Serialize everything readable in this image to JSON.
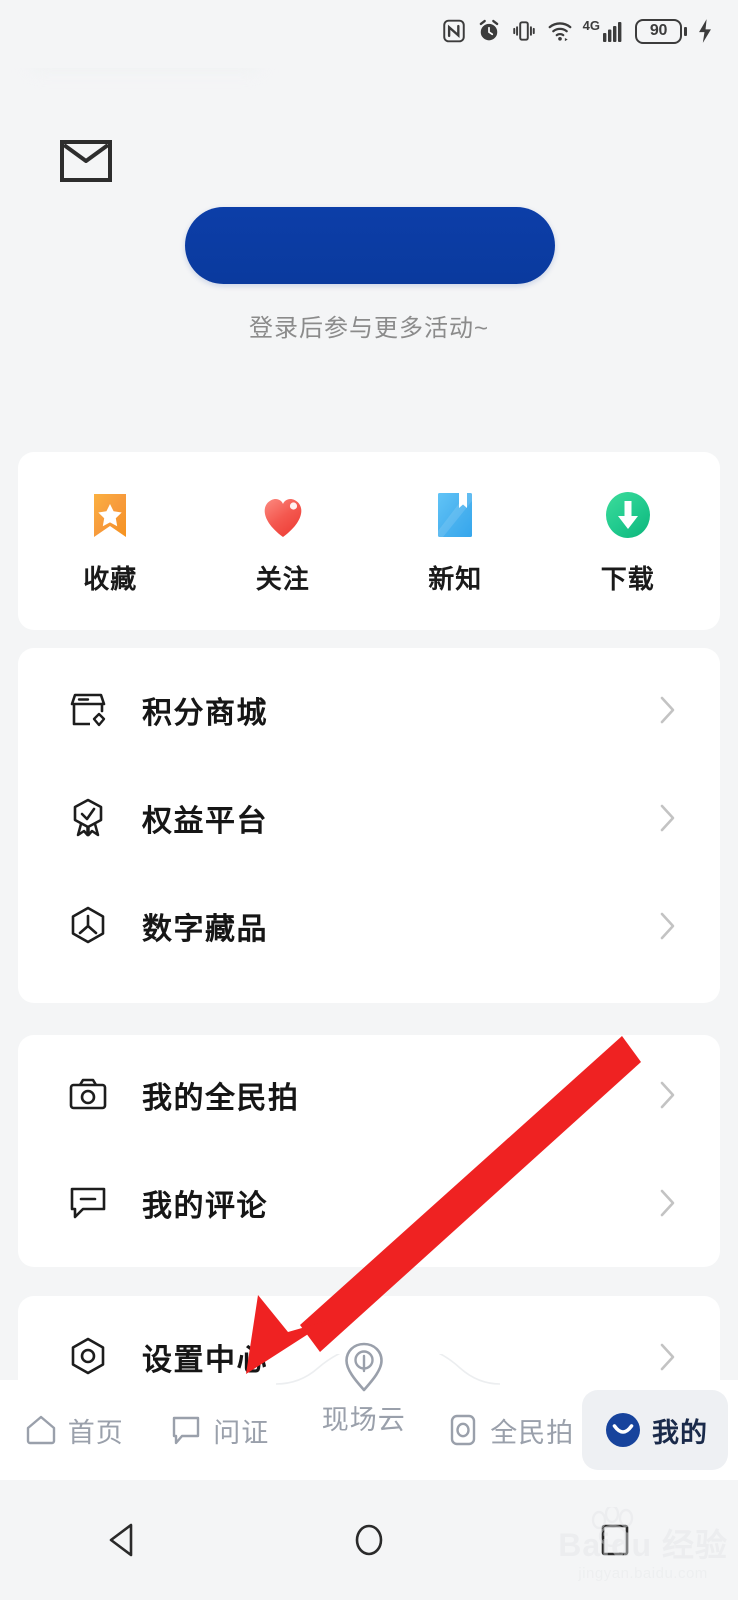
{
  "status_bar": {
    "battery_level": "90",
    "icons": [
      "nfc-icon",
      "alarm-icon",
      "vibrate-icon",
      "wifi-icon",
      "signal-4g-icon",
      "battery-icon",
      "charging-bolt-icon"
    ],
    "network": "4G"
  },
  "header": {
    "mail_icon": "envelope-icon",
    "login_button_label": "",
    "login_hint": "登录后参与更多活动~"
  },
  "quick_actions": [
    {
      "label": "收藏",
      "icon": "bookmark-star-icon",
      "color": "#f7a23b"
    },
    {
      "label": "关注",
      "icon": "heart-icon",
      "color": "#f4584f"
    },
    {
      "label": "新知",
      "icon": "book-bookmark-icon",
      "color": "#4db4f0"
    },
    {
      "label": "下载",
      "icon": "download-circle-icon",
      "color": "#1ec88a"
    }
  ],
  "service_items": [
    {
      "label": "积分商城",
      "icon": "shop-icon"
    },
    {
      "label": "权益平台",
      "icon": "medal-badge-icon"
    },
    {
      "label": "数字藏品",
      "icon": "hexagon-collection-icon"
    }
  ],
  "mine_items": [
    {
      "label": "我的全民拍",
      "icon": "camera-icon"
    },
    {
      "label": "我的评论",
      "icon": "comment-icon"
    }
  ],
  "settings_items": [
    {
      "label": "设置中心",
      "icon": "settings-hexagon-icon"
    }
  ],
  "bottom_nav": [
    {
      "label": "首页",
      "icon": "home-icon",
      "active": false
    },
    {
      "label": "问证",
      "icon": "chat-icon",
      "active": false
    },
    {
      "label": "现场云",
      "icon": "location-pin-icon",
      "active": false
    },
    {
      "label": "全民拍",
      "icon": "camera-outline-icon",
      "active": false
    },
    {
      "label": "我的",
      "icon": "profile-smile-icon",
      "active": true
    }
  ],
  "system_nav": [
    {
      "name": "back-button",
      "icon": "triangle-left-icon"
    },
    {
      "name": "home-button",
      "icon": "circle-icon"
    },
    {
      "name": "recents-button",
      "icon": "square-icon"
    }
  ],
  "annotation": {
    "type": "red-arrow",
    "points_to": "设置中心",
    "color": "#ef2222"
  },
  "watermark": {
    "brand": "Baidu 经验",
    "url": "jingyan.baidu.com"
  },
  "colors": {
    "page_background": "#f4f5f6",
    "card_background": "#ffffff",
    "primary_blue": "#0c3ea8",
    "text_primary": "#161616",
    "text_muted": "#8b8b8b",
    "nav_inactive": "#9aa0ab",
    "annotation_red": "#ef2222"
  }
}
